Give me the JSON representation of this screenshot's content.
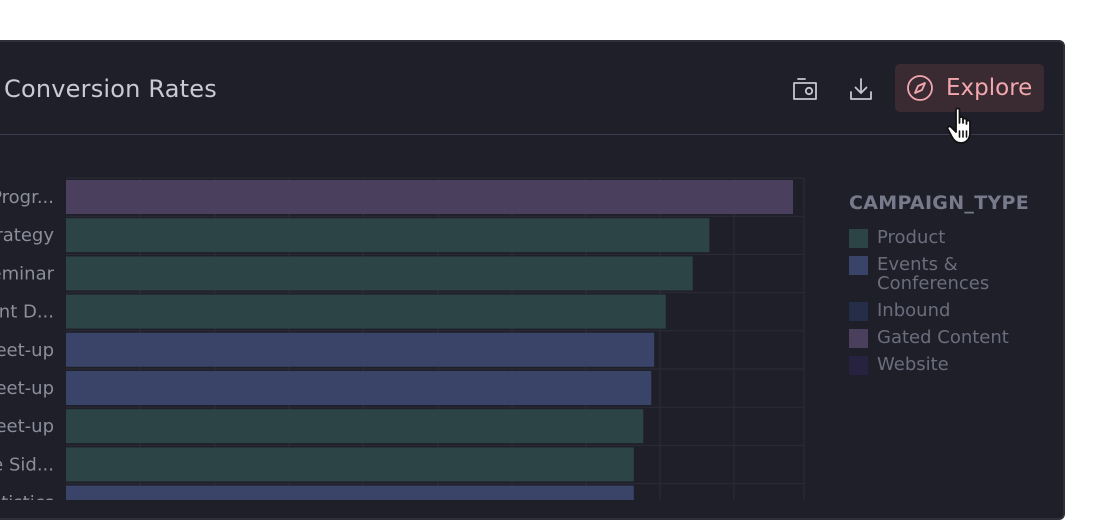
{
  "card": {
    "title": "_ Conversion Rates",
    "explore_label": "Explore"
  },
  "icons": {
    "camera": "camera-icon",
    "download": "download-icon",
    "explore": "compass-icon",
    "cursor": "hand-pointer-cursor-icon"
  },
  "colors": {
    "card_bg": "#1f1f29",
    "explore_bg": "#3a2b33",
    "explore_text": "#f3a6ad",
    "product": "#2c4446",
    "events": "#394468",
    "inbound": "#262d48",
    "gated": "#4a3f5c",
    "website": "#26223f"
  },
  "chart_data": {
    "type": "bar",
    "orientation": "horizontal",
    "categories": [
      "Progr...",
      "rategy",
      "eminar",
      "nt D...",
      "eet-up",
      "eet-up",
      "eet-up",
      "e Sid...",
      "tistics"
    ],
    "values": [
      100,
      88.5,
      86.2,
      82.5,
      80.9,
      80.5,
      79.4,
      78.1,
      78.1
    ],
    "bar_groups": [
      "Gated Content",
      "Product",
      "Product",
      "Product",
      "Events & Conferences",
      "Events & Conferences",
      "Product",
      "Product",
      "Events & Conferences"
    ],
    "xlim": [
      0,
      100
    ],
    "grid": true,
    "legend": {
      "title": "CAMPAIGN_TYPE",
      "position": "right",
      "entries": [
        {
          "label": "Product",
          "color": "#2c4446"
        },
        {
          "label": "Events & Conferences",
          "color": "#394468"
        },
        {
          "label": "Inbound",
          "color": "#262d48"
        },
        {
          "label": "Gated Content",
          "color": "#4a3f5c"
        },
        {
          "label": "Website",
          "color": "#26223f"
        }
      ]
    }
  }
}
